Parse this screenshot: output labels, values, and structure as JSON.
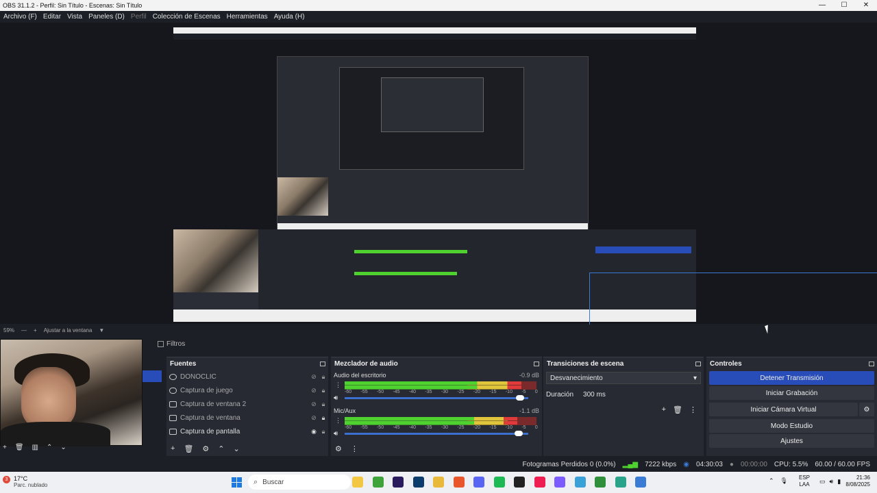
{
  "window": {
    "title": "OBS 31.1.2 - Perfil: Sin Título - Escenas: Sin Título",
    "controls": [
      "—",
      "☐",
      "✕"
    ]
  },
  "menu": [
    {
      "label": "Archivo (F)",
      "enabled": true
    },
    {
      "label": "Editar",
      "enabled": true
    },
    {
      "label": "Vista",
      "enabled": true
    },
    {
      "label": "Paneles (D)",
      "enabled": true
    },
    {
      "label": "Perfil",
      "enabled": false
    },
    {
      "label": "Colección de Escenas",
      "enabled": true
    },
    {
      "label": "Herramientas",
      "enabled": true
    },
    {
      "label": "Ayuda (H)",
      "enabled": true
    }
  ],
  "zoom": {
    "level": "59%",
    "minus": "—",
    "plus": "+",
    "fit_label": "Ajustar a la ventana",
    "caret": "▼"
  },
  "filters_tab": "Filtros",
  "sources": {
    "title": "Fuentes",
    "items": [
      {
        "label": "DONOCLIC",
        "icon": "browser-icon",
        "visible": false,
        "locked": true
      },
      {
        "label": "Captura de juego",
        "icon": "gamepad-icon",
        "visible": false,
        "locked": true
      },
      {
        "label": "Captura de ventana 2",
        "icon": "window-icon",
        "visible": false,
        "locked": true
      },
      {
        "label": "Captura de ventana",
        "icon": "window-icon",
        "visible": false,
        "locked": true
      },
      {
        "label": "Captura de pantalla",
        "icon": "monitor-icon",
        "visible": true,
        "locked": true
      }
    ],
    "toolbar": [
      "+",
      "🗑",
      "⚙",
      "⌃",
      "⌄"
    ]
  },
  "mixer": {
    "title": "Mezclador de audio",
    "channels": [
      {
        "name": "Audio del escritorio",
        "db": "-0.9 dB",
        "level": 0.92
      },
      {
        "name": "Mic/Aux",
        "db": "-1.1 dB",
        "level": 0.9
      }
    ],
    "ticks": [
      "-60",
      "-55",
      "-50",
      "-45",
      "-40",
      "-35",
      "-30",
      "-25",
      "-20",
      "-15",
      "-10",
      "-5",
      "0"
    ]
  },
  "transitions": {
    "title": "Transiciones de escena",
    "selected": "Desvanecimiento",
    "duration_label": "Duración",
    "duration_value": "300 ms"
  },
  "controls": {
    "title": "Controles",
    "buttons": [
      "Detener Transmisión",
      "Iniciar Grabación",
      "Iniciar Cámara Virtual",
      "Modo Estudio",
      "Ajustes"
    ]
  },
  "status": {
    "dropped": "Fotogramas Perdidos 0 (0.0%)",
    "bitrate": "7222 kbps",
    "stream_time": "04:30:03",
    "rec_time": "00:00:00",
    "cpu": "CPU: 5.5%",
    "fps": "60.00 / 60.00 FPS"
  },
  "taskbar": {
    "temp": "17°C",
    "weather": "Parc. nublado",
    "badge": "3",
    "search": "Buscar",
    "lang1": "ESP",
    "lang2": "LAA",
    "time": "21:36",
    "date": "8/08/2025",
    "apps": [
      {
        "name": "explorer-icon",
        "color": "#f2c744"
      },
      {
        "name": "minecraft-icon",
        "color": "#3ea33a"
      },
      {
        "name": "premiere-icon",
        "color": "#2a1a5e"
      },
      {
        "name": "photoshop-icon",
        "color": "#0b3c6b"
      },
      {
        "name": "folder-icon",
        "color": "#e8b93a"
      },
      {
        "name": "brave-icon",
        "color": "#e9562c"
      },
      {
        "name": "discord-icon",
        "color": "#5865f2"
      },
      {
        "name": "spotify-icon",
        "color": "#1db954"
      },
      {
        "name": "obs-icon",
        "color": "#222222"
      },
      {
        "name": "tiktok-icon",
        "color": "#ee1d52"
      },
      {
        "name": "app-icon",
        "color": "#7c5cff"
      },
      {
        "name": "snip-icon",
        "color": "#3aa0d8"
      },
      {
        "name": "box-icon",
        "color": "#2f8f3a"
      },
      {
        "name": "notes-icon",
        "color": "#2aa38b"
      },
      {
        "name": "calc-icon",
        "color": "#3a7bd5"
      }
    ]
  }
}
